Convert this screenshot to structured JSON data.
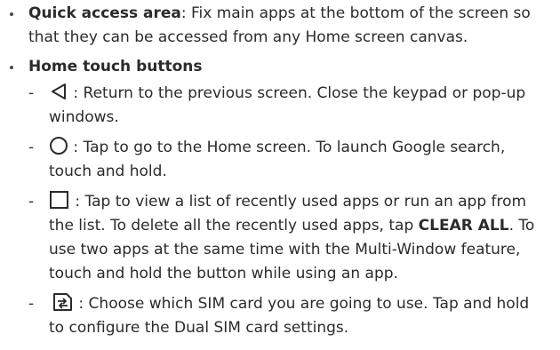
{
  "quick_access": {
    "term": "Quick access area",
    "separator": ":",
    "description": "Fix main apps at the bottom of the screen so that they can be accessed from any Home screen canvas."
  },
  "home_touch_buttons": {
    "heading": "Home touch buttons",
    "items": [
      {
        "icon": "back-triangle-icon",
        "text": "Return to the previous screen. Close the keypad or pop-up windows."
      },
      {
        "icon": "home-circle-icon",
        "text": "Tap to go to the Home screen. To launch Google search, touch and hold."
      },
      {
        "icon": "recent-apps-square-icon",
        "text_before": "Tap to view a list of recently used apps or run an app from the list. To delete all the recently used apps, tap ",
        "bold": "CLEAR ALL",
        "text_after": ". To use two apps at the same time with the Multi-Window feature, touch and hold the button while using an app."
      },
      {
        "icon": "sim-switch-icon",
        "text": "Choose which SIM card you are going to use. Tap and hold to configure the Dual SIM card settings."
      }
    ]
  }
}
